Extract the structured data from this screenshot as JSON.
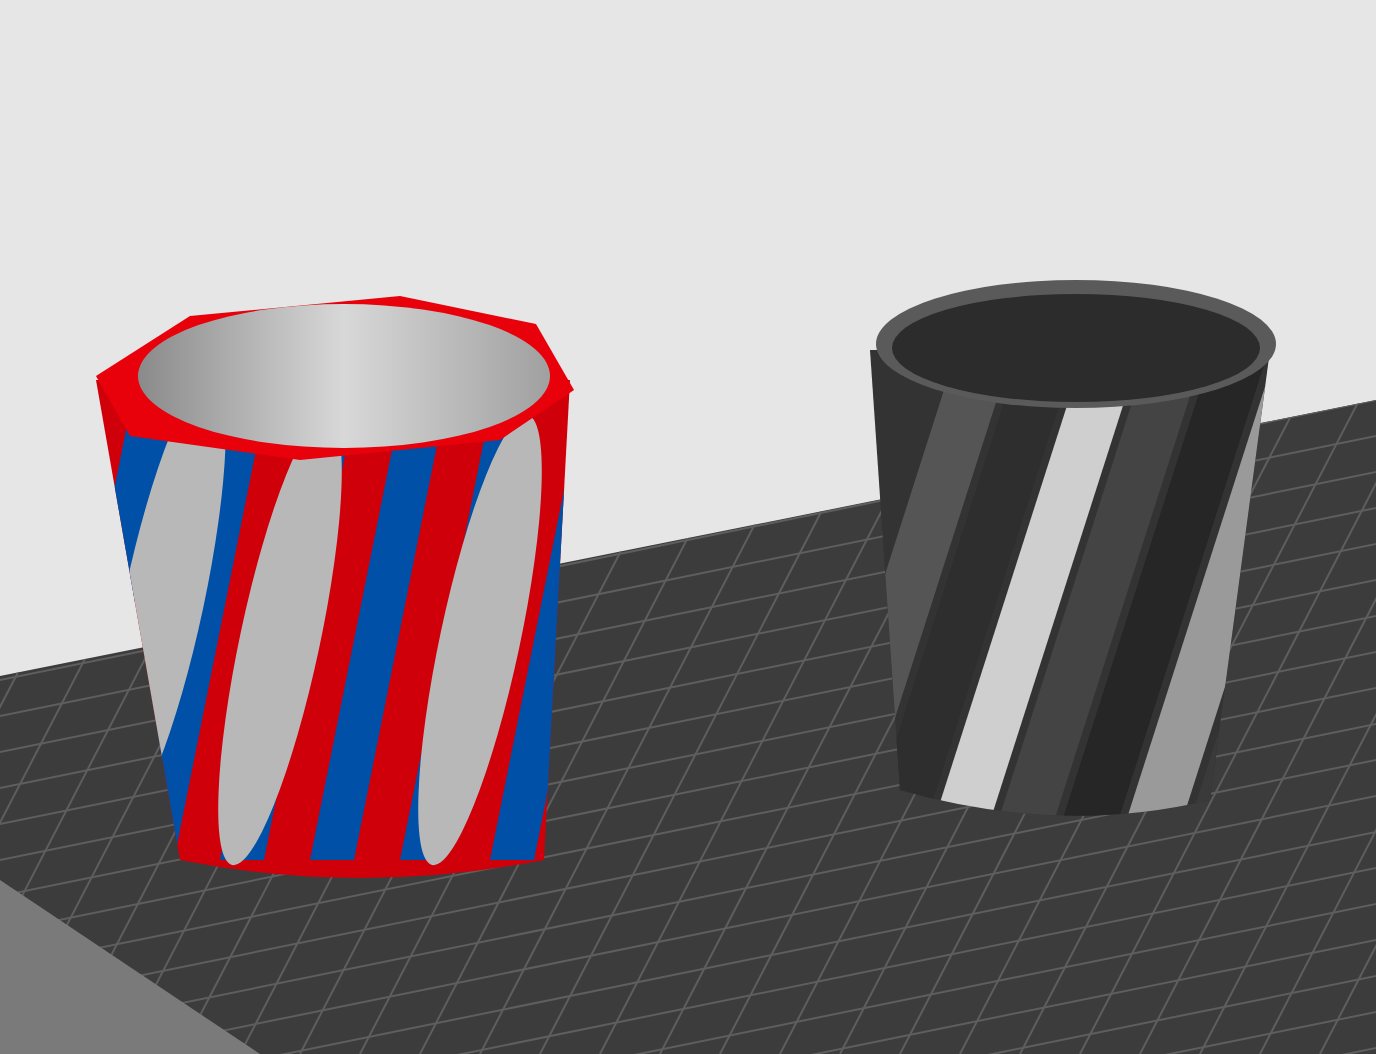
{
  "viewport": {
    "objects": [
      {
        "kind": "striped-cup"
      },
      {
        "kind": "twisted-cup"
      }
    ]
  }
}
